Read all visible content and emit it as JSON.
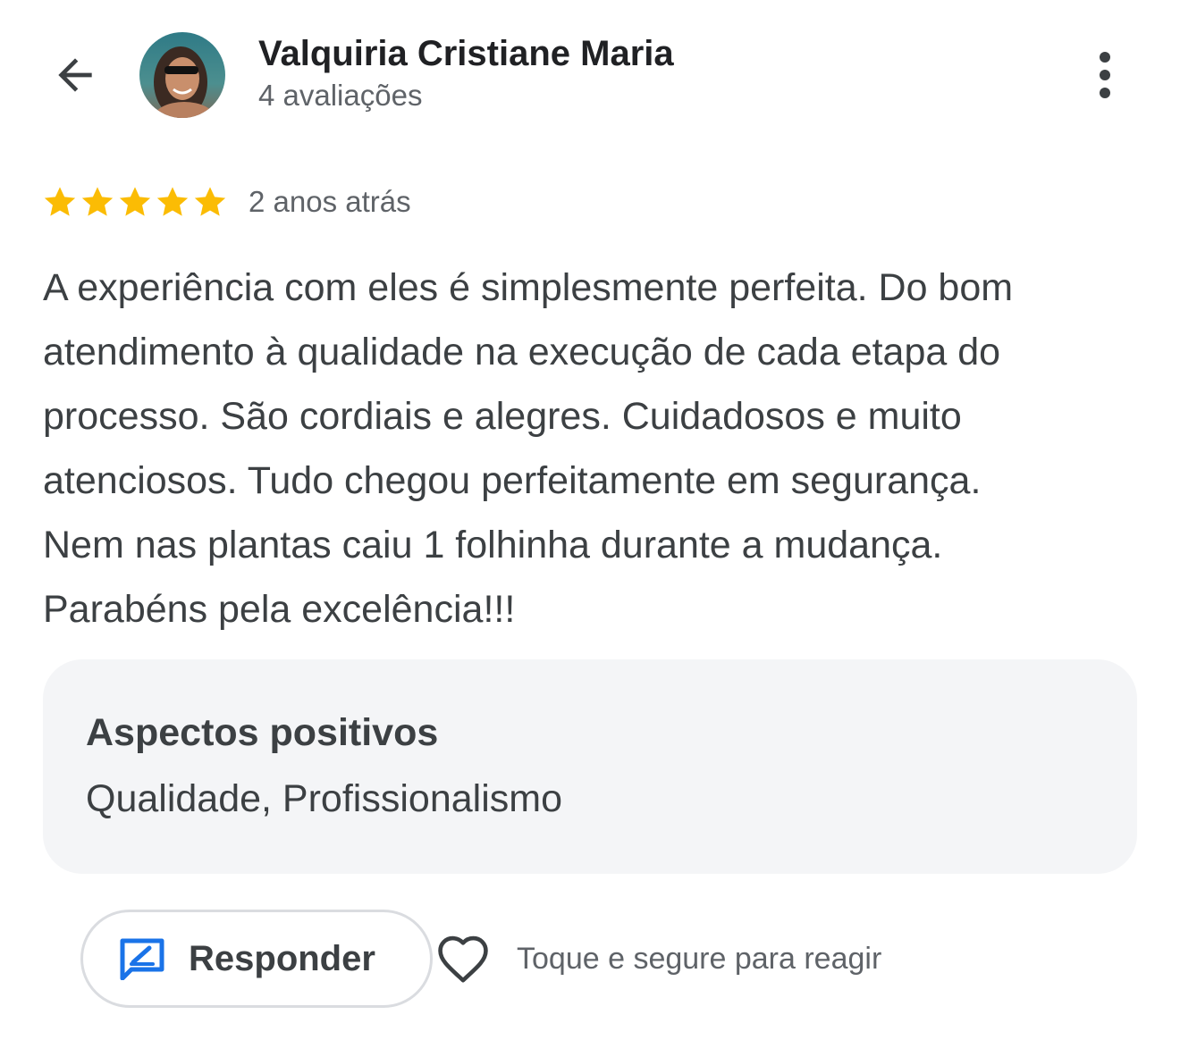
{
  "header": {
    "back_icon": "arrow-left-icon",
    "avatar": "reviewer-avatar",
    "reviewer_name": "Valquiria Cristiane Maria",
    "review_count": "4 avaliações",
    "more_icon": "more-vertical-icon"
  },
  "review": {
    "rating": 5,
    "rating_max": 5,
    "star_color": "#fbbc04",
    "date": "2 anos atrás",
    "text": "A experiência com eles é simplesmente perfeita. Do bom\natendimento à qualidade na execução de cada etapa do\nprocesso. São cordiais e alegres. Cuidadosos e muito\natenciosos. Tudo chegou perfeitamente em segurança.\nNem nas plantas caiu 1 folhinha durante a mudança.\nParabéns pela excelência!!!"
  },
  "aspects": {
    "title": "Aspectos positivos",
    "values": "Qualidade, Profissionalismo"
  },
  "actions": {
    "reply_icon": "reply-edit-icon",
    "reply_label": "Responder",
    "reply_icon_color": "#1a73e8",
    "heart_icon": "heart-outline-icon",
    "react_hint": "Toque e segure para reagir"
  }
}
